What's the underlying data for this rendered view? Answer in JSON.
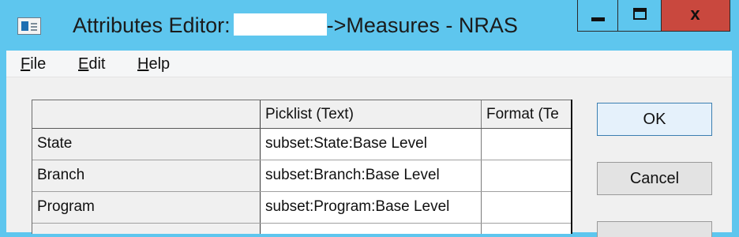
{
  "window": {
    "title_prefix": "Attributes Editor:",
    "title_suffix": "->Measures - NRAS",
    "controls": {
      "minimize_icon": "minimize-icon",
      "maximize_icon": "maximize-icon",
      "close_glyph": "x"
    }
  },
  "menu": [
    {
      "mnemonic": "F",
      "rest": "ile"
    },
    {
      "mnemonic": "E",
      "rest": "dit"
    },
    {
      "mnemonic": "H",
      "rest": "elp"
    }
  ],
  "grid": {
    "columns": [
      "",
      "Picklist (Text)",
      "Format (Te"
    ],
    "rows": [
      {
        "name": "State",
        "picklist": "subset:State:Base Level",
        "format": ""
      },
      {
        "name": "Branch",
        "picklist": "subset:Branch:Base Level",
        "format": ""
      },
      {
        "name": "Program",
        "picklist": "subset:Program:Base Level",
        "format": ""
      }
    ]
  },
  "buttons": {
    "ok": "OK",
    "cancel": "Cancel"
  },
  "colors": {
    "titlebar": "#5ec6ee",
    "close": "#c9483e",
    "client": "#f0f0f0"
  }
}
